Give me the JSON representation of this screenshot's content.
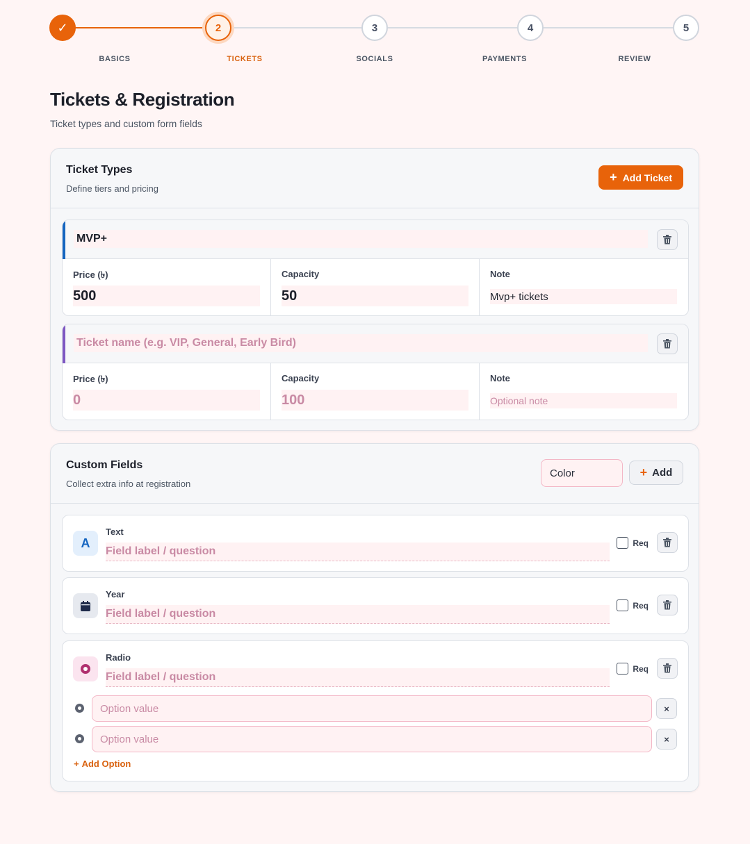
{
  "stepper": {
    "steps": [
      {
        "number": "✓",
        "label": "BASICS",
        "state": "done"
      },
      {
        "number": "2",
        "label": "TICKETS",
        "state": "active"
      },
      {
        "number": "3",
        "label": "SOCIALS",
        "state": "todo"
      },
      {
        "number": "4",
        "label": "PAYMENTS",
        "state": "todo"
      },
      {
        "number": "5",
        "label": "REVIEW",
        "state": "todo"
      }
    ]
  },
  "header": {
    "title": "Tickets & Registration",
    "subtitle": "Ticket types and custom form fields"
  },
  "ticket_types": {
    "title": "Ticket Types",
    "subtitle": "Define tiers and pricing",
    "add_button": "Add Ticket",
    "add_icon": "+",
    "tickets": [
      {
        "name": "MVP+",
        "name_placeholder": "Ticket name (e.g. VIP, General, Early Bird)",
        "accent_color": "#1565c0",
        "price_label": "Price (৳)",
        "price": "500",
        "capacity_label": "Capacity",
        "capacity": "50",
        "note_label": "Note",
        "note": "Mvp+ tickets"
      },
      {
        "name": "",
        "name_placeholder": "Ticket name (e.g. VIP, General, Early Bird)",
        "accent_color": "#7e57c2",
        "price_label": "Price (৳)",
        "price_placeholder": "0",
        "capacity_label": "Capacity",
        "capacity_placeholder": "100",
        "note_label": "Note",
        "note_placeholder": "Optional note"
      }
    ]
  },
  "custom_fields": {
    "title": "Custom Fields",
    "subtitle": "Collect extra info at registration",
    "type_input_value": "Color",
    "add_button": "Add",
    "add_icon": "+",
    "fields": [
      {
        "type": "Text",
        "icon": "text-type-icon",
        "glyph": "A",
        "label_placeholder": "Field label / question",
        "req_label": "Req"
      },
      {
        "type": "Year",
        "icon": "calendar-icon",
        "label_placeholder": "Field label / question",
        "req_label": "Req"
      },
      {
        "type": "Radio",
        "icon": "radio-icon",
        "label_placeholder": "Field label / question",
        "req_label": "Req",
        "options": [
          {
            "placeholder": "Option value",
            "remove": "×"
          },
          {
            "placeholder": "Option value",
            "remove": "×"
          }
        ],
        "add_option": "Add Option",
        "add_option_icon": "+"
      }
    ]
  },
  "colors": {
    "accent": "#e8630a",
    "background": "#fff5f5",
    "placeholder": "#c98aa4"
  }
}
